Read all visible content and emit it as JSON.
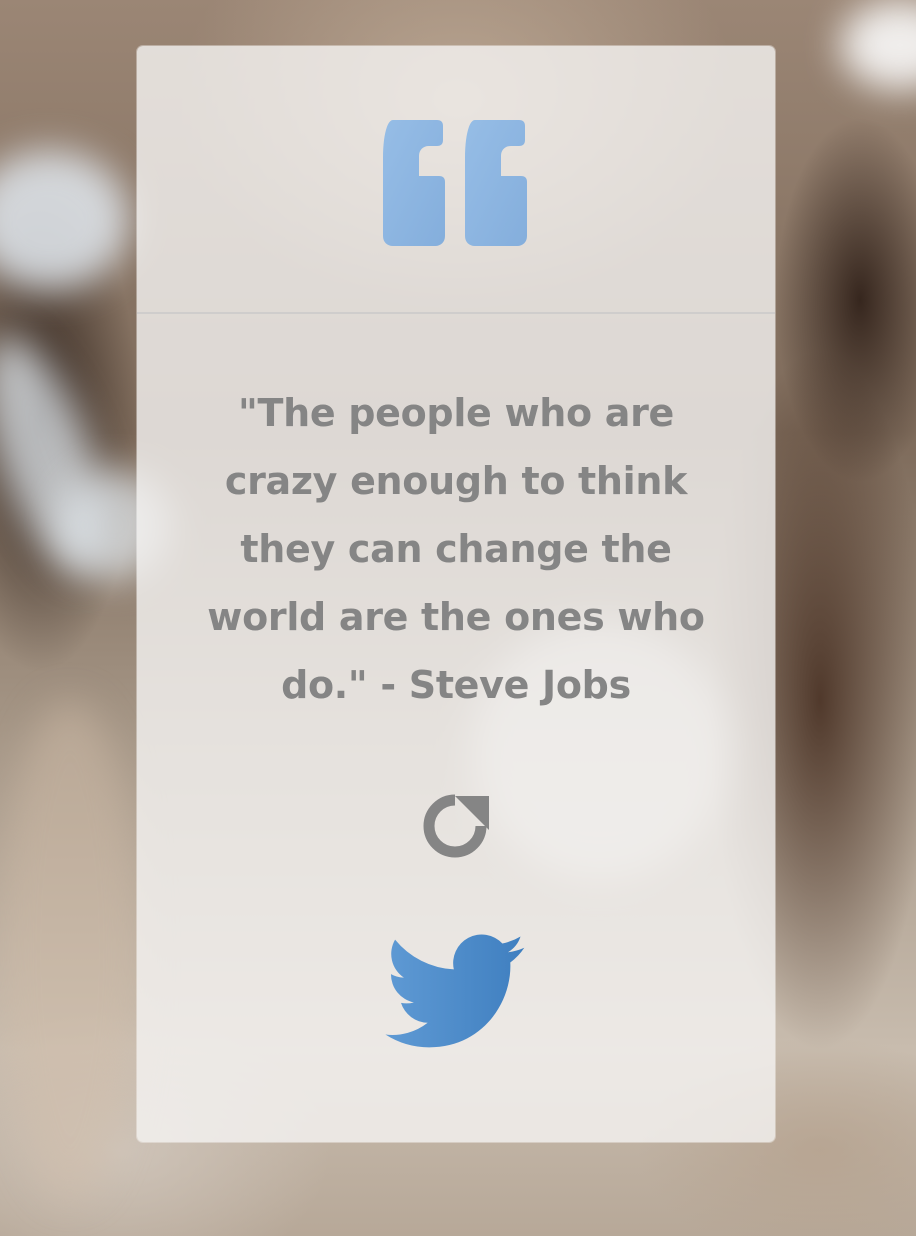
{
  "quote": {
    "text": "\"The people who are crazy enough to think they can change the world are the ones who do.\" - Steve Jobs"
  },
  "icons": {
    "quote_mark": "quote-left-icon",
    "refresh": "refresh-icon",
    "tweet": "twitter-icon"
  },
  "colors": {
    "quote_mark": "#8fb6e0",
    "quote_text": "#858585",
    "refresh": "#858585",
    "twitter": "#4a89c8",
    "card_background": "rgba(245,244,242,0.80)"
  }
}
